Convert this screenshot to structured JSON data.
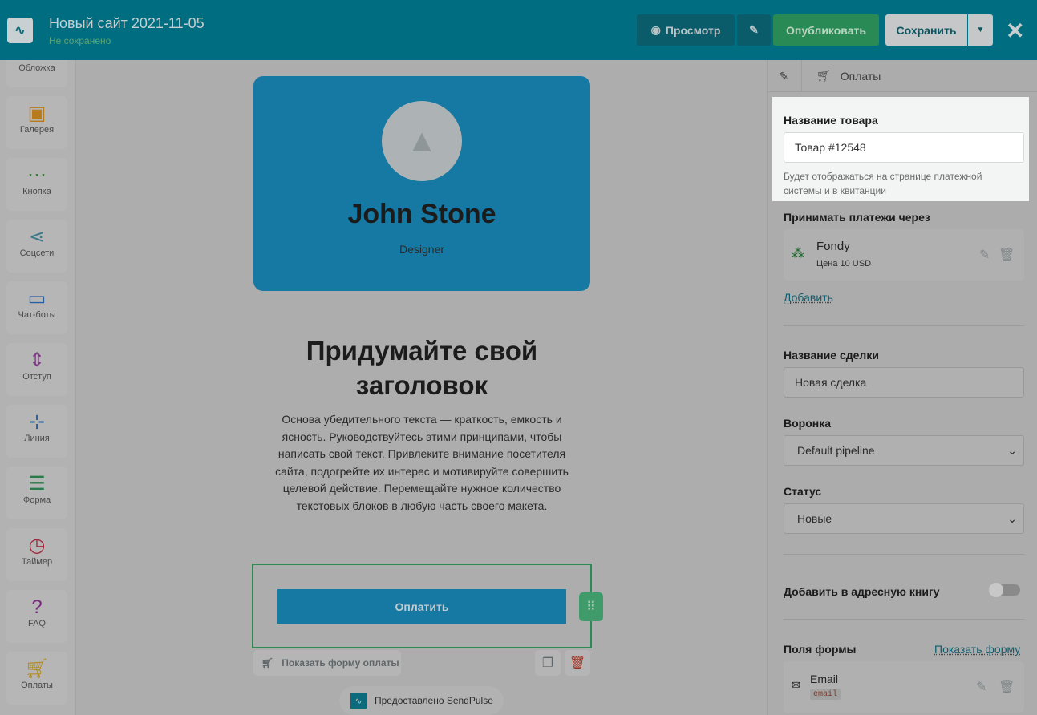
{
  "header": {
    "title": "Новый сайт 2021-11-05",
    "status": "Не сохранено",
    "preview": "Просмотр",
    "publish": "Опубликовать",
    "save": "Сохранить"
  },
  "sidebar": {
    "items": [
      {
        "label": "Обложка",
        "icon": "cover-icon",
        "color": "#6b3d7a"
      },
      {
        "label": "Галерея",
        "icon": "gallery-icon",
        "color": "#b87a1a"
      },
      {
        "label": "Кнопка",
        "icon": "button-icon",
        "color": "#3d7d3a"
      },
      {
        "label": "Соцсети",
        "icon": "share-icon",
        "color": "#3f7a8c"
      },
      {
        "label": "Чат-боты",
        "icon": "chat-icon",
        "color": "#2a5fa0"
      },
      {
        "label": "Отступ",
        "icon": "spacing-icon",
        "color": "#7a3d80"
      },
      {
        "label": "Линия",
        "icon": "line-icon",
        "color": "#2a5fa0"
      },
      {
        "label": "Форма",
        "icon": "form-icon",
        "color": "#2a7a4a"
      },
      {
        "label": "Таймер",
        "icon": "timer-icon",
        "color": "#a0283a"
      },
      {
        "label": "FAQ",
        "icon": "faq-icon",
        "color": "#7a2a80"
      },
      {
        "label": "Оплаты",
        "icon": "cart-icon",
        "color": "#b08a1a"
      }
    ]
  },
  "canvas": {
    "name": "John Stone",
    "role": "Designer",
    "headline": "Придумайте свой заголовок",
    "body": "Основа убедительного текста — краткость, емкость и ясность. Руководствуйтесь этими принципами, чтобы написать свой текст. Привлеките внимание посетителя сайта, подогрейте их интерес и мотивируйте совершить целевой действие. Перемещайте нужное количество текстовых блоков в любую часть своего макета.",
    "pay_button": "Оплатить",
    "show_form": "Показать форму оплаты",
    "powered": "Предоставлено SendPulse"
  },
  "panel": {
    "breadcrumb": "Оплаты",
    "product_label": "Название товара",
    "product_value": "Товар #12548",
    "product_hint": "Будет отображаться на странице платежной системы и в квитанции",
    "accept_label": "Принимать платежи через",
    "provider_name": "Fondy",
    "provider_price": "Цена 10 USD",
    "add": "Добавить",
    "deal_label": "Название сделки",
    "deal_value": "Новая сделка",
    "funnel_label": "Воронка",
    "funnel_value": "Default pipeline",
    "status_label": "Статус",
    "status_value": "Новые",
    "addressbook_label": "Добавить в адресную книгу",
    "addressbook_on": false,
    "fields_label": "Поля формы",
    "show_form": "Показать форму",
    "field_name": "Email",
    "field_tag": "email"
  }
}
